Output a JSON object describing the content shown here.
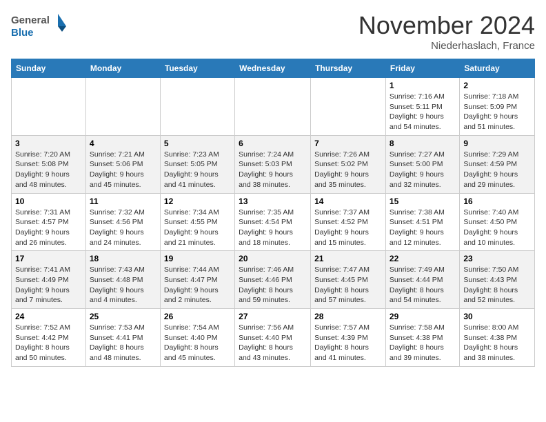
{
  "header": {
    "logo_general": "General",
    "logo_blue": "Blue",
    "month_title": "November 2024",
    "location": "Niederhaslach, France"
  },
  "weekdays": [
    "Sunday",
    "Monday",
    "Tuesday",
    "Wednesday",
    "Thursday",
    "Friday",
    "Saturday"
  ],
  "weeks": [
    [
      {
        "day": "",
        "info": ""
      },
      {
        "day": "",
        "info": ""
      },
      {
        "day": "",
        "info": ""
      },
      {
        "day": "",
        "info": ""
      },
      {
        "day": "",
        "info": ""
      },
      {
        "day": "1",
        "info": "Sunrise: 7:16 AM\nSunset: 5:11 PM\nDaylight: 9 hours\nand 54 minutes."
      },
      {
        "day": "2",
        "info": "Sunrise: 7:18 AM\nSunset: 5:09 PM\nDaylight: 9 hours\nand 51 minutes."
      }
    ],
    [
      {
        "day": "3",
        "info": "Sunrise: 7:20 AM\nSunset: 5:08 PM\nDaylight: 9 hours\nand 48 minutes."
      },
      {
        "day": "4",
        "info": "Sunrise: 7:21 AM\nSunset: 5:06 PM\nDaylight: 9 hours\nand 45 minutes."
      },
      {
        "day": "5",
        "info": "Sunrise: 7:23 AM\nSunset: 5:05 PM\nDaylight: 9 hours\nand 41 minutes."
      },
      {
        "day": "6",
        "info": "Sunrise: 7:24 AM\nSunset: 5:03 PM\nDaylight: 9 hours\nand 38 minutes."
      },
      {
        "day": "7",
        "info": "Sunrise: 7:26 AM\nSunset: 5:02 PM\nDaylight: 9 hours\nand 35 minutes."
      },
      {
        "day": "8",
        "info": "Sunrise: 7:27 AM\nSunset: 5:00 PM\nDaylight: 9 hours\nand 32 minutes."
      },
      {
        "day": "9",
        "info": "Sunrise: 7:29 AM\nSunset: 4:59 PM\nDaylight: 9 hours\nand 29 minutes."
      }
    ],
    [
      {
        "day": "10",
        "info": "Sunrise: 7:31 AM\nSunset: 4:57 PM\nDaylight: 9 hours\nand 26 minutes."
      },
      {
        "day": "11",
        "info": "Sunrise: 7:32 AM\nSunset: 4:56 PM\nDaylight: 9 hours\nand 24 minutes."
      },
      {
        "day": "12",
        "info": "Sunrise: 7:34 AM\nSunset: 4:55 PM\nDaylight: 9 hours\nand 21 minutes."
      },
      {
        "day": "13",
        "info": "Sunrise: 7:35 AM\nSunset: 4:54 PM\nDaylight: 9 hours\nand 18 minutes."
      },
      {
        "day": "14",
        "info": "Sunrise: 7:37 AM\nSunset: 4:52 PM\nDaylight: 9 hours\nand 15 minutes."
      },
      {
        "day": "15",
        "info": "Sunrise: 7:38 AM\nSunset: 4:51 PM\nDaylight: 9 hours\nand 12 minutes."
      },
      {
        "day": "16",
        "info": "Sunrise: 7:40 AM\nSunset: 4:50 PM\nDaylight: 9 hours\nand 10 minutes."
      }
    ],
    [
      {
        "day": "17",
        "info": "Sunrise: 7:41 AM\nSunset: 4:49 PM\nDaylight: 9 hours\nand 7 minutes."
      },
      {
        "day": "18",
        "info": "Sunrise: 7:43 AM\nSunset: 4:48 PM\nDaylight: 9 hours\nand 4 minutes."
      },
      {
        "day": "19",
        "info": "Sunrise: 7:44 AM\nSunset: 4:47 PM\nDaylight: 9 hours\nand 2 minutes."
      },
      {
        "day": "20",
        "info": "Sunrise: 7:46 AM\nSunset: 4:46 PM\nDaylight: 8 hours\nand 59 minutes."
      },
      {
        "day": "21",
        "info": "Sunrise: 7:47 AM\nSunset: 4:45 PM\nDaylight: 8 hours\nand 57 minutes."
      },
      {
        "day": "22",
        "info": "Sunrise: 7:49 AM\nSunset: 4:44 PM\nDaylight: 8 hours\nand 54 minutes."
      },
      {
        "day": "23",
        "info": "Sunrise: 7:50 AM\nSunset: 4:43 PM\nDaylight: 8 hours\nand 52 minutes."
      }
    ],
    [
      {
        "day": "24",
        "info": "Sunrise: 7:52 AM\nSunset: 4:42 PM\nDaylight: 8 hours\nand 50 minutes."
      },
      {
        "day": "25",
        "info": "Sunrise: 7:53 AM\nSunset: 4:41 PM\nDaylight: 8 hours\nand 48 minutes."
      },
      {
        "day": "26",
        "info": "Sunrise: 7:54 AM\nSunset: 4:40 PM\nDaylight: 8 hours\nand 45 minutes."
      },
      {
        "day": "27",
        "info": "Sunrise: 7:56 AM\nSunset: 4:40 PM\nDaylight: 8 hours\nand 43 minutes."
      },
      {
        "day": "28",
        "info": "Sunrise: 7:57 AM\nSunset: 4:39 PM\nDaylight: 8 hours\nand 41 minutes."
      },
      {
        "day": "29",
        "info": "Sunrise: 7:58 AM\nSunset: 4:38 PM\nDaylight: 8 hours\nand 39 minutes."
      },
      {
        "day": "30",
        "info": "Sunrise: 8:00 AM\nSunset: 4:38 PM\nDaylight: 8 hours\nand 38 minutes."
      }
    ]
  ]
}
